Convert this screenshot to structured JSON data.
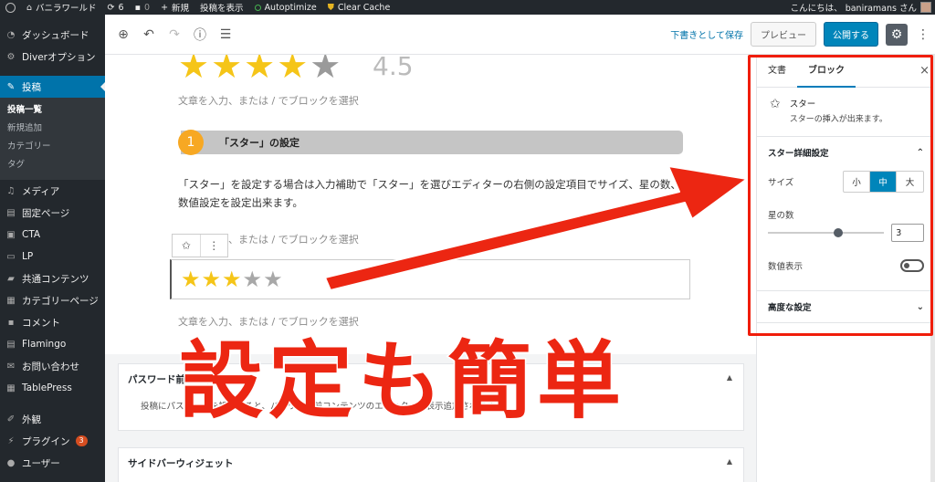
{
  "admin_bar": {
    "site_name": "バニラワールド",
    "updates_count": "6",
    "comments_count": "0",
    "new_label": "新規",
    "view_post_label": "投稿を表示",
    "autoptimize_label": "Autoptimize",
    "clear_cache_label": "Clear Cache",
    "greeting": "こんにちは、 baniramans さん"
  },
  "sidebar": {
    "items": [
      {
        "label": "ダッシュボード",
        "icon": "dashboard-icon"
      },
      {
        "label": "Diverオプション",
        "icon": "gear-icon"
      },
      {
        "label": "投稿",
        "icon": "pin-icon"
      },
      {
        "label": "メディア",
        "icon": "media-icon"
      },
      {
        "label": "固定ページ",
        "icon": "page-icon"
      },
      {
        "label": "CTA",
        "icon": "cta-icon"
      },
      {
        "label": "LP",
        "icon": "lp-icon"
      },
      {
        "label": "共通コンテンツ",
        "icon": "folder-icon"
      },
      {
        "label": "カテゴリーページ",
        "icon": "category-icon"
      },
      {
        "label": "コメント",
        "icon": "comment-icon"
      },
      {
        "label": "Flamingo",
        "icon": "flamingo-icon"
      },
      {
        "label": "お問い合わせ",
        "icon": "mail-icon"
      },
      {
        "label": "TablePress",
        "icon": "table-icon"
      },
      {
        "label": "外観",
        "icon": "brush-icon"
      },
      {
        "label": "プラグイン",
        "icon": "plugin-icon",
        "badge": "3"
      },
      {
        "label": "ユーザー",
        "icon": "user-icon"
      }
    ],
    "submenu": [
      "投稿一覧",
      "新規追加",
      "カテゴリー",
      "タグ"
    ]
  },
  "toolbar": {
    "save_draft": "下書きとして保存",
    "preview": "プレビュー",
    "publish": "公開する"
  },
  "content": {
    "rating_value": "4.5",
    "placeholder_1": "文章を入力、または / でブロックを選択",
    "heading_number": "1",
    "heading_text": "「スター」の設定",
    "paragraph": "「スター」を設定する場合は入力補助で「スター」を選びエディターの右側の設定項目でサイズ、星の数、数値設定を設定出来ます。",
    "placeholder_2": "文章を入力、または / でブロックを選択",
    "placeholder_3": "文章を入力、または / でブロックを選択",
    "stars_filled": 3,
    "stars_total": 5,
    "meta_password_title": "パスワード前コンテンツ",
    "meta_password_body": "投稿にパスワードを設定すると、パスワード前コンテンツのエディターが表示追加されます。",
    "meta_sidebar_title": "サイドバーウィジェット"
  },
  "panel": {
    "tab_document": "文書",
    "tab_block": "ブロック",
    "block_name": "スター",
    "block_desc": "スターの挿入が出来ます。",
    "section_star_settings": "スター詳細設定",
    "size_label": "サイズ",
    "size_options": [
      "小",
      "中",
      "大"
    ],
    "size_selected": "中",
    "star_count_label": "星の数",
    "star_count_value": "3",
    "star_count_max": 5,
    "show_value_label": "数値表示",
    "show_value_on": false,
    "section_advanced": "高度な設定"
  },
  "overlay": {
    "caption": "設定も簡単",
    "highlight_color": "#f01d0a"
  }
}
